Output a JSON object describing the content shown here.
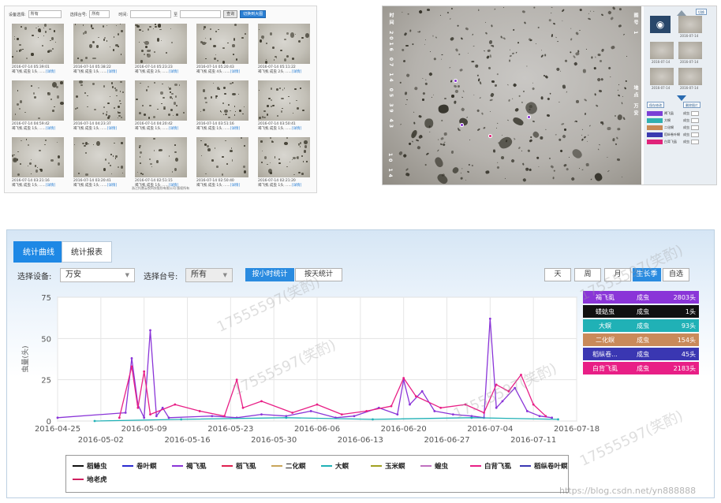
{
  "gallery": {
    "toolbar": {
      "device_label": "设备选择:",
      "device_value": "所有",
      "lamp_label": "选择台号:",
      "lamp_value": "所有",
      "time_label": "时间:",
      "to_label": "至",
      "query_button": "查询",
      "export_button": "切换到大图"
    },
    "items": [
      {
        "time": "2016-07-14 05:39:01",
        "caption": "褐飞虱 成虫 1头 ......",
        "link": "[详情]"
      },
      {
        "time": "2016-07-14 05:38:22",
        "caption": "褐飞虱 成虫 1头 ......",
        "link": "[详情]"
      },
      {
        "time": "2016-07-14 05:23:23",
        "caption": "褐飞虱 成虫 2头 ......",
        "link": "[详情]"
      },
      {
        "time": "2016-07-14 05:20:43",
        "caption": "褐飞虱 成虫 4头 ......",
        "link": "[详情]"
      },
      {
        "time": "2016-07-14 05:11:22",
        "caption": "褐飞虱 成虫 2头 ......",
        "link": "[详情]"
      },
      {
        "time": "2016-07-14 04:59:42",
        "caption": "褐飞虱 成虫 1头 ......",
        "link": "[详情]"
      },
      {
        "time": "2016-07-14 04:23:37",
        "caption": "褐飞虱 成虫 1头 ......",
        "link": "[详情]"
      },
      {
        "time": "2016-07-14 04:20:42",
        "caption": "褐飞虱 成虫 1头 ......",
        "link": "[详情]"
      },
      {
        "time": "2016-07-14 03:51:16",
        "caption": "褐飞虱 成虫 1头 ......",
        "link": "[详情]"
      },
      {
        "time": "2016-07-14 03:50:41",
        "caption": "褐飞虱 成虫 1头 ......",
        "link": "[详情]"
      },
      {
        "time": "2016-07-14 03:21:16",
        "caption": "褐飞虱 成虫 1头 ......",
        "link": "[详情]"
      },
      {
        "time": "2016-07-14 03:20:41",
        "caption": "褐飞虱 成虫 1头 ......",
        "link": "[详情]"
      },
      {
        "time": "2016-07-14 02:51:15",
        "caption": "褐飞虱 成虫 1头 ......",
        "link": "[详情]"
      },
      {
        "time": "2016-07-14 02:50:40",
        "caption": "褐飞虱 成虫 1头 ......",
        "link": "[详情]"
      },
      {
        "time": "2016-07-14 02:21:20",
        "caption": "褐飞虱 成虫 1头 ......",
        "link": "[详情]"
      }
    ],
    "footer": "浙江托普云农科技股份有限公司 版权所有"
  },
  "detail": {
    "overlay_left": "时间 2016 07 14 05 39 43",
    "overlay_bottom_left": "10 14",
    "overlay_right_top": "图号 1",
    "overlay_right_mid": "地点 万安",
    "side": {
      "top_button": "切换",
      "thumb_labels": [
        "2016-07-14",
        "2016-07-14",
        "2016-07-14",
        "2016-07-14",
        "2016-07-14",
        "2016-07-14",
        "2016-07-14"
      ],
      "btn_a": "保存修改",
      "btn_b": "删除图片",
      "rows": [
        {
          "name": "褐飞虱",
          "stage": "成虫",
          "color": "#7a3fd6"
        },
        {
          "name": "大螟",
          "stage": "成虫",
          "color": "#2fb0b0"
        },
        {
          "name": "二化螟",
          "stage": "成虫",
          "color": "#c88a55"
        },
        {
          "name": "稻纵卷叶螟",
          "stage": "成虫",
          "color": "#3a3ab0"
        },
        {
          "name": "白背飞虱",
          "stage": "成虫",
          "color": "#e0237a"
        }
      ]
    }
  },
  "main": {
    "tabs": [
      "统计曲线",
      "统计报表"
    ],
    "device_label": "选择设备:",
    "device_value": "万安",
    "lamp_label": "选择台号:",
    "lamp_value": "所有",
    "hourly_button": "按小时统计",
    "daily_button": "按天统计",
    "range_buttons": [
      "天",
      "周",
      "月",
      "生长季",
      "自选"
    ],
    "y_axis_label": "虫量(头)",
    "legend_table": [
      {
        "name": "褐飞虱",
        "stage": "成虫",
        "count": "2803头",
        "color": "#8a35d8"
      },
      {
        "name": "蝼蛄虫",
        "stage": "成虫",
        "count": "1头",
        "color": "#111111"
      },
      {
        "name": "大螟",
        "stage": "成虫",
        "count": "93头",
        "color": "#20b1b6"
      },
      {
        "name": "二化螟",
        "stage": "成虫",
        "count": "154头",
        "color": "#c98a5a"
      },
      {
        "name": "稻纵卷...",
        "stage": "成虫",
        "count": "45头",
        "color": "#3a37b2"
      },
      {
        "name": "白背飞虱",
        "stage": "成虫",
        "count": "2183头",
        "color": "#e81f86"
      }
    ],
    "bottom_legend": [
      {
        "name": "稻蝽虫",
        "color": "#111111"
      },
      {
        "name": "卷叶螟",
        "color": "#2a2ad0"
      },
      {
        "name": "褐飞虱",
        "color": "#8a35d8"
      },
      {
        "name": "稻飞虱",
        "color": "#e02050"
      },
      {
        "name": "二化螟",
        "color": "#c9a55a"
      },
      {
        "name": "大螟",
        "color": "#20b1b6"
      },
      {
        "name": "玉米螟",
        "color": "#a0a020"
      },
      {
        "name": "蝗虫",
        "color": "#c070c0"
      },
      {
        "name": "白背飞虱",
        "color": "#e81f86"
      },
      {
        "name": "稻纵卷叶螟",
        "color": "#3a37b2"
      },
      {
        "name": "地老虎",
        "color": "#d02060"
      }
    ],
    "watermarks": [
      "17555597(笑酌)",
      "17555597(笑酌)",
      "17555597(笑酌)",
      "17555597(笑酌)",
      "17555597(笑酌)"
    ],
    "url_watermark": "https://blog.csdn.net/yn888888"
  },
  "chart_data": {
    "type": "line",
    "ylim": [
      0,
      75
    ],
    "yticks": [
      0,
      25,
      50,
      75
    ],
    "ylabel": "虫量(头)",
    "xlim": [
      "2016-04-25",
      "2016-07-18"
    ],
    "xticks_upper": [
      "2016-04-25",
      "2016-05-09",
      "2016-05-23",
      "2016-06-06",
      "2016-06-20",
      "2016-07-04",
      "2016-07-18"
    ],
    "xticks_lower": [
      "2016-05-02",
      "2016-05-16",
      "2016-05-30",
      "2016-06-13",
      "2016-06-27",
      "2016-07-11"
    ],
    "series": [
      {
        "name": "褐飞虱",
        "color": "#8a35d8",
        "x": [
          "2016-04-25",
          "2016-05-06",
          "2016-05-07",
          "2016-05-08",
          "2016-05-09",
          "2016-05-10",
          "2016-05-11",
          "2016-05-12",
          "2016-05-13",
          "2016-05-20",
          "2016-05-24",
          "2016-05-28",
          "2016-06-01",
          "2016-06-05",
          "2016-06-09",
          "2016-06-12",
          "2016-06-16",
          "2016-06-19",
          "2016-06-20",
          "2016-06-21",
          "2016-06-23",
          "2016-06-25",
          "2016-06-28",
          "2016-07-01",
          "2016-07-03",
          "2016-07-04",
          "2016-07-05",
          "2016-07-06",
          "2016-07-08",
          "2016-07-10",
          "2016-07-12",
          "2016-07-14"
        ],
        "y": [
          2,
          5,
          38,
          10,
          2,
          55,
          3,
          8,
          2,
          3,
          2,
          4,
          3,
          6,
          2,
          3,
          8,
          4,
          25,
          10,
          18,
          6,
          4,
          3,
          2,
          62,
          8,
          12,
          20,
          6,
          3,
          2
        ]
      },
      {
        "name": "白背飞虱",
        "color": "#e81f86",
        "x": [
          "2016-05-05",
          "2016-05-07",
          "2016-05-08",
          "2016-05-09",
          "2016-05-10",
          "2016-05-14",
          "2016-05-18",
          "2016-05-22",
          "2016-05-24",
          "2016-05-25",
          "2016-05-28",
          "2016-06-02",
          "2016-06-06",
          "2016-06-10",
          "2016-06-14",
          "2016-06-18",
          "2016-06-20",
          "2016-06-22",
          "2016-06-26",
          "2016-06-30",
          "2016-07-03",
          "2016-07-05",
          "2016-07-07",
          "2016-07-09",
          "2016-07-11",
          "2016-07-13"
        ],
        "y": [
          2,
          33,
          8,
          30,
          4,
          10,
          6,
          3,
          25,
          8,
          12,
          5,
          10,
          4,
          6,
          9,
          26,
          15,
          8,
          10,
          5,
          22,
          18,
          28,
          10,
          3
        ]
      },
      {
        "name": "大螟",
        "color": "#20b1b6",
        "x": [
          "2016-05-01",
          "2016-05-15",
          "2016-06-01",
          "2016-06-15",
          "2016-07-01",
          "2016-07-15"
        ],
        "y": [
          0,
          1,
          2,
          1,
          2,
          1
        ]
      }
    ]
  }
}
